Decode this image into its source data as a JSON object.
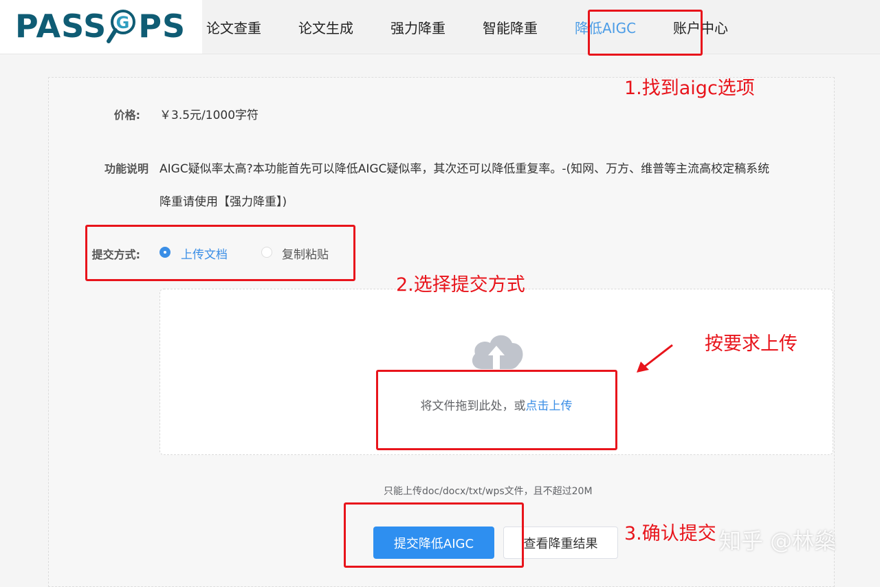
{
  "logo": {
    "text_left": "PASS",
    "text_right": "PS",
    "magnifier_letter": "G"
  },
  "nav": {
    "items": [
      "论文查重",
      "论文生成",
      "强力降重",
      "智能降重",
      "降低AIGC",
      "账户中心"
    ],
    "active_index": 4
  },
  "form": {
    "price_label": "价格:",
    "price_value": "￥3.5元/1000字符",
    "desc_label": "功能说明",
    "desc_line1": "AIGC疑似率太高?本功能首先可以降低AIGC疑似率，其次还可以降低重复率。-(知网、万方、维普等主流高校定稿系统",
    "desc_line2": "降重请使用【强力降重】)",
    "submit_label": "提交方式:",
    "option_upload": "上传文档",
    "option_paste": "复制粘贴",
    "selected_option": "上传文档"
  },
  "upload": {
    "icon": "cloud-upload-icon",
    "hint_prefix": "将文件拖到此处，或",
    "hint_link": "点击上传",
    "note": "只能上传doc/docx/txt/wps文件，且不超过20M"
  },
  "actions": {
    "submit": "提交降低AIGC",
    "view_results": "查看降重结果"
  },
  "annotations": {
    "step1": "1.找到aigc选项",
    "step2": "2.选择提交方式",
    "upload_tip": "按要求上传",
    "step3": "3.确认提交"
  },
  "watermark": "知乎 @林燊",
  "colors": {
    "accent": "#3a8ee6",
    "annotation": "#e8141b",
    "logo": "#0f5c74"
  }
}
